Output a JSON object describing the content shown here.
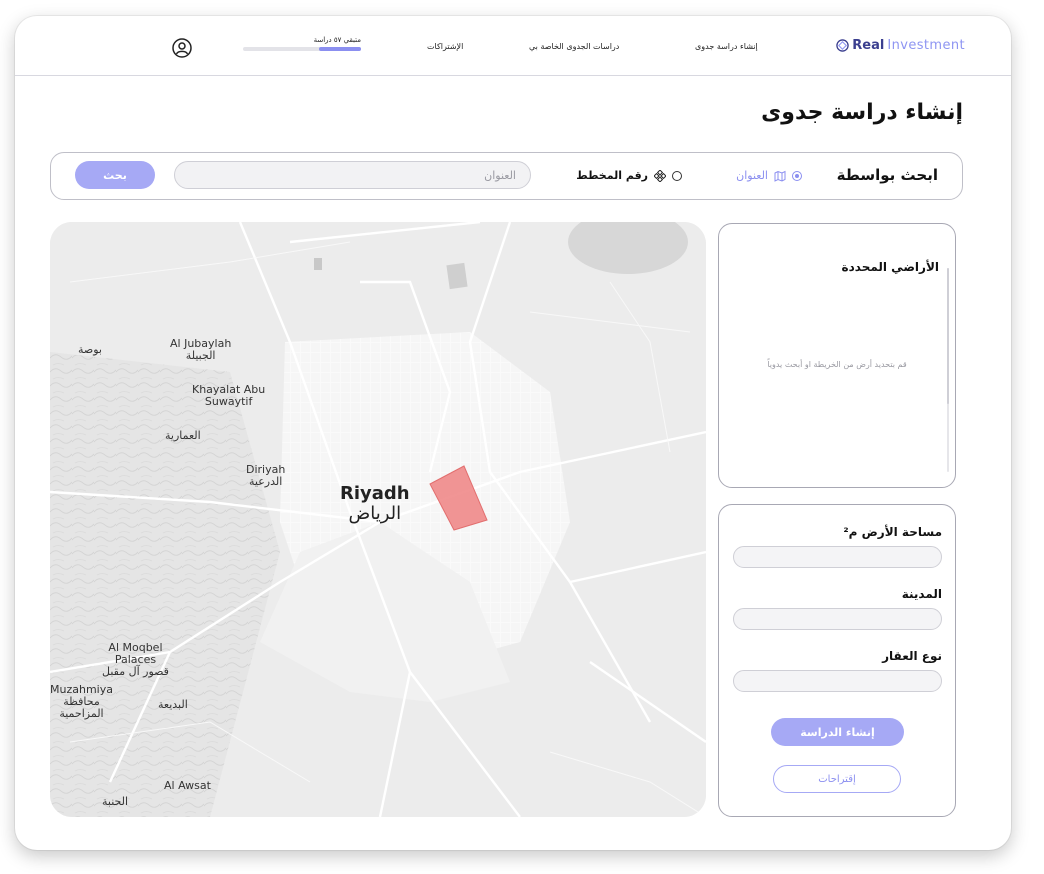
{
  "nav": {
    "brand_part1": "Real",
    "brand_part2": "Investment",
    "create_study": "إنشاء دراسة جدوى",
    "my_studies": "دراسات الجدوى الخاصة بي",
    "subscriptions": "الإشتراكات",
    "quota_text": "متبقي ٥٧ دراسة",
    "quota_fill_fraction": 0.36
  },
  "page": {
    "title": "إنشاء دراسة جدوى"
  },
  "search": {
    "label": "ابحث بواسطة",
    "option_address": "العنوان",
    "option_plan_number": "رقم المخطط",
    "selected_option": "address",
    "input_placeholder": "العنوان",
    "button_label": "بحث"
  },
  "map": {
    "labels": {
      "busah": "بوصة",
      "al_jubaylah_en": "Al Jubaylah",
      "al_jubaylah_ar": "الجبيلة",
      "khayalat_en1": "Khayalat Abu",
      "khayalat_en2": "Suwaytif",
      "amariyah": "العمارية",
      "diriyah_en": "Diriyah",
      "diriyah_ar": "الدرعية",
      "riyadh_en": "Riyadh",
      "riyadh_ar": "الرياض",
      "moqbel_en1": "Al Moqbel",
      "moqbel_en2": "Palaces",
      "moqbel_ar": "قصور آل مقبل",
      "muzahmiya_en": "Muzahmiya",
      "muzahmiya_ar1": "محافظة",
      "muzahmiya_ar2": "المزاحمية",
      "badiah": "البديعة",
      "awsat_en": "Al Awsat",
      "hanbah": "الحنبة"
    },
    "selection_color": "#f08a8a"
  },
  "lands": {
    "title": "الأراضي المحددة",
    "empty_hint": "قم بتحديد أرض من الخريطة او أبحث يدوياً"
  },
  "form": {
    "area_label": "مساحة الأرض م²",
    "city_label": "المدينة",
    "property_type_label": "نوع العقار",
    "create_button": "إنشاء الدراسة",
    "suggestions_button": "إقتراحات"
  },
  "colors": {
    "accent": "#a6a9f5",
    "accent_dark": "#3b3f8f"
  }
}
